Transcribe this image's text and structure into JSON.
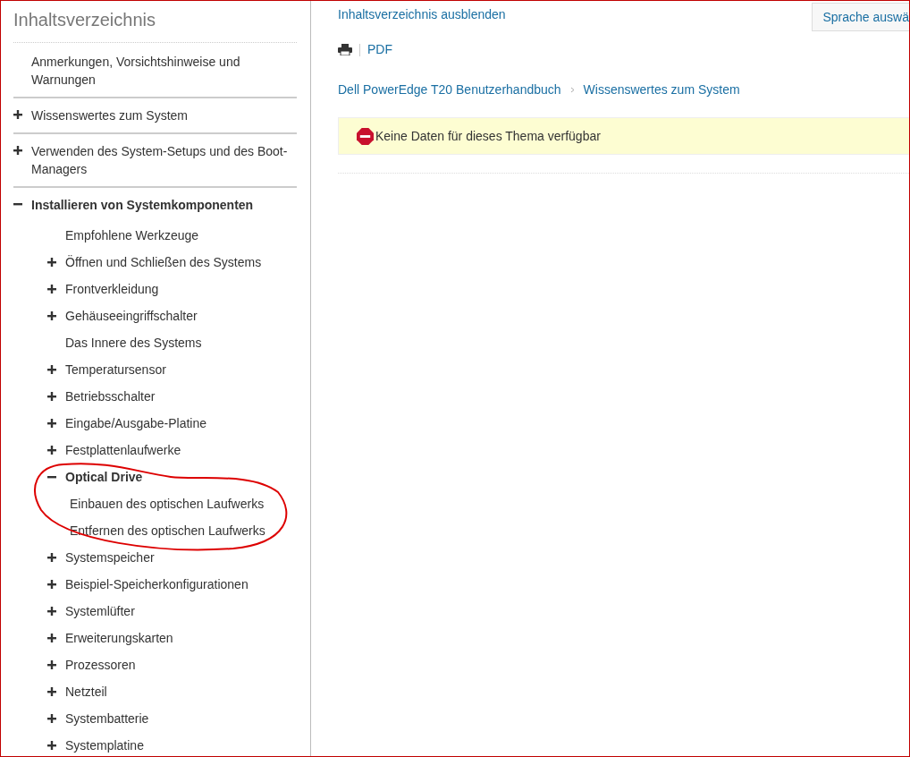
{
  "sidebar": {
    "title": "Inhaltsverzeichnis",
    "items": [
      {
        "label": "Anmerkungen, Vorsichtshinweise und Warnungen",
        "kind": "leaf",
        "expanded": false
      },
      {
        "label": "Wissenswertes zum System",
        "kind": "node",
        "expanded": false
      },
      {
        "label": "Verwenden des System-Setups und des Boot-Managers",
        "kind": "node",
        "expanded": false
      },
      {
        "label": "Installieren von Systemkomponenten",
        "kind": "node",
        "expanded": true,
        "children": [
          {
            "label": "Empfohlene Werkzeuge",
            "kind": "leaf",
            "expanded": false
          },
          {
            "label": "Öffnen und Schließen des Systems",
            "kind": "node",
            "expanded": false
          },
          {
            "label": "Frontverkleidung",
            "kind": "node",
            "expanded": false
          },
          {
            "label": "Gehäuseeingriffschalter",
            "kind": "node",
            "expanded": false
          },
          {
            "label": "Das Innere des Systems",
            "kind": "leaf",
            "expanded": false
          },
          {
            "label": "Temperatursensor",
            "kind": "node",
            "expanded": false
          },
          {
            "label": "Betriebsschalter",
            "kind": "node",
            "expanded": false
          },
          {
            "label": "Eingabe/Ausgabe-Platine",
            "kind": "node",
            "expanded": false
          },
          {
            "label": "Festplattenlaufwerke",
            "kind": "node",
            "expanded": false
          },
          {
            "label": "Optical Drive",
            "kind": "node",
            "expanded": true,
            "children": [
              {
                "label": "Einbauen des optischen Laufwerks",
                "kind": "leaf",
                "expanded": false
              },
              {
                "label": "Entfernen des optischen Laufwerks",
                "kind": "leaf",
                "expanded": false
              }
            ]
          },
          {
            "label": "Systemspeicher",
            "kind": "node",
            "expanded": false
          },
          {
            "label": "Beispiel-Speicherkonfigurationen",
            "kind": "node",
            "expanded": false
          },
          {
            "label": "Systemlüfter",
            "kind": "node",
            "expanded": false
          },
          {
            "label": "Erweiterungskarten",
            "kind": "node",
            "expanded": false
          },
          {
            "label": "Prozessoren",
            "kind": "node",
            "expanded": false
          },
          {
            "label": "Netzteil",
            "kind": "node",
            "expanded": false
          },
          {
            "label": "Systembatterie",
            "kind": "node",
            "expanded": false
          },
          {
            "label": "Systemplatine",
            "kind": "node",
            "expanded": false
          }
        ]
      }
    ]
  },
  "main": {
    "toggle_link": "Inhaltsverzeichnis ausblenden",
    "language_button": "Sprache auswä",
    "pdf_link": "PDF",
    "breadcrumb": [
      "Dell PowerEdge T20 Benutzerhandbuch",
      "Wissenswertes zum System"
    ],
    "message": "Keine Daten für dieses Thema verfügbar"
  }
}
